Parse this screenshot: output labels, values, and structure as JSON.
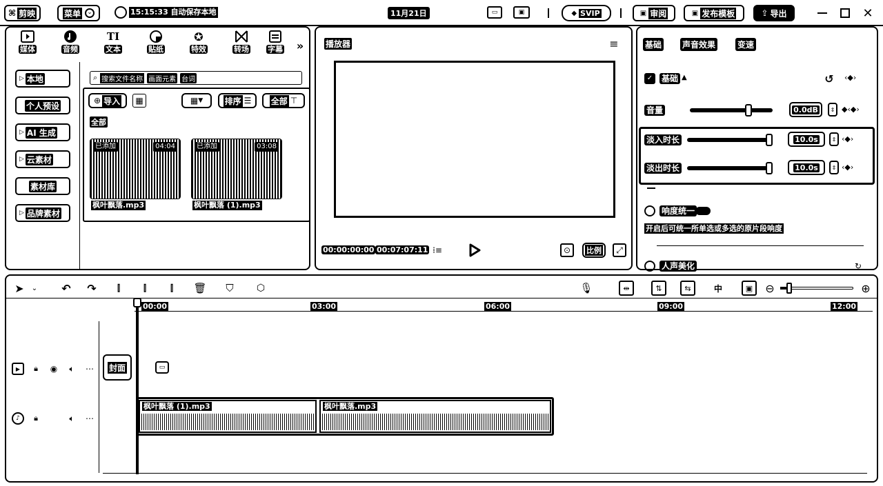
{
  "topbar": {
    "app_name": "剪映",
    "menu_label": "菜单",
    "autosave": "15:15:33 自动保存本地",
    "project_title": "11月21日",
    "svip_label": "SVIP",
    "review_label": "审阅",
    "publish_template_label": "发布模板",
    "export_label": "导出"
  },
  "media": {
    "tabs": [
      {
        "label": "媒体",
        "icon": "media-icon"
      },
      {
        "label": "音频",
        "icon": "audio-icon"
      },
      {
        "label": "文本",
        "icon": "text-icon"
      },
      {
        "label": "贴纸",
        "icon": "sticker-icon"
      },
      {
        "label": "特效",
        "icon": "effects-icon"
      },
      {
        "label": "转场",
        "icon": "transition-icon"
      },
      {
        "label": "字幕",
        "icon": "subtitle-icon"
      }
    ],
    "sidebar": [
      "本地",
      "个人预设",
      "AI 生成",
      "云素材",
      "素材库",
      "品牌素材"
    ],
    "search_placeholder": "搜索文件名称",
    "search_chips": [
      "画面元素",
      "台词"
    ],
    "import_label": "导入",
    "sort_label": "排序",
    "filter_label": "全部",
    "category_label": "全部",
    "files": [
      {
        "name": "枫叶飘落.mp3",
        "badge": "已添加",
        "duration": "04:04"
      },
      {
        "name": "枫叶飘落 (1).mp3",
        "badge": "已添加",
        "duration": "03:08"
      }
    ]
  },
  "player": {
    "title": "播放器",
    "current_time": "00:00:00:00",
    "total_time": "00:07:07:11",
    "ratio_label": "比例"
  },
  "props": {
    "tabs": [
      "基础",
      "声音效果",
      "变速"
    ],
    "section_label": "基础",
    "volume_label": "音量",
    "volume_value": "0.0dB",
    "volume_level": 0.8,
    "fadein_label": "淡入时长",
    "fadein_value": "10.0s",
    "fadein_level": 1.0,
    "fadeout_label": "淡出时长",
    "fadeout_value": "10.0s",
    "fadeout_level": 1.0,
    "loudness_label": "响度统一",
    "loudness_desc": "开启后可统一所单选或多选的原片段响度",
    "voice_label": "人声美化"
  },
  "timeline": {
    "ruler": [
      "00:00",
      "03:00",
      "06:00",
      "09:00",
      "12:00"
    ],
    "cover_label": "封面",
    "clips": [
      {
        "name": "枫叶飘落 (1).mp3"
      },
      {
        "name": "枫叶飘落.mp3"
      }
    ]
  },
  "colors": {
    "fg": "#000000",
    "bg": "#ffffff"
  }
}
